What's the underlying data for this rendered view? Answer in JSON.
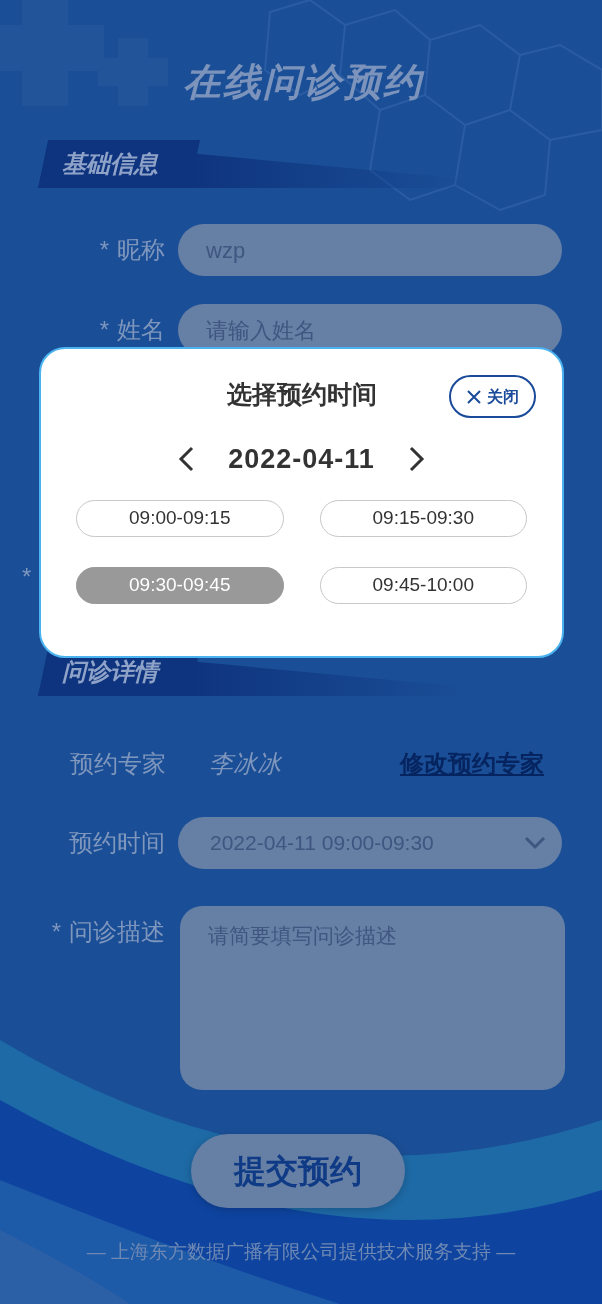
{
  "title": "在线问诊预约",
  "basic_info": {
    "title": "基础信息",
    "fields": [
      {
        "mark": "*",
        "label": "昵称",
        "value": "wzp"
      },
      {
        "mark": "*",
        "label": "姓名",
        "placeholder": "请输入姓名"
      }
    ],
    "hidden_field_mark": "*"
  },
  "details": {
    "title": "问诊详情",
    "expert": {
      "label": "预约专家",
      "value": "李冰冰",
      "link": "修改预约专家"
    },
    "time": {
      "label": "预约时间",
      "value": "2022-04-11 09:00-09:30"
    },
    "description": {
      "mark": "*",
      "label": "问诊描述",
      "placeholder": "请简要填写问诊描述"
    }
  },
  "submit": "提交预约",
  "footer": "— 上海东方数据广播有限公司提供技术服务支持 —",
  "dialog": {
    "title": "选择预约时间",
    "close": "关闭",
    "date": "2022-04-11",
    "slots": [
      {
        "label": "09:00-09:15",
        "selected": false
      },
      {
        "label": "09:15-09:30",
        "selected": false
      },
      {
        "label": "09:30-09:45",
        "selected": true
      },
      {
        "label": "09:45-10:00",
        "selected": false
      }
    ]
  }
}
